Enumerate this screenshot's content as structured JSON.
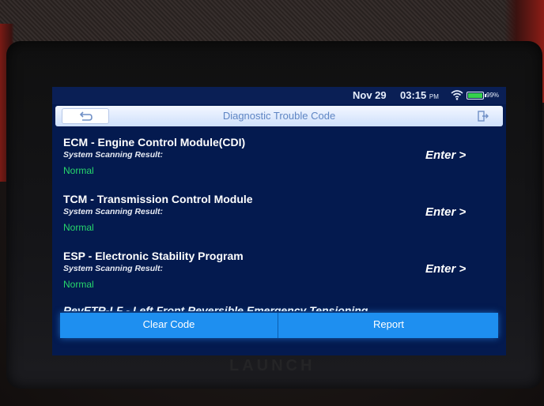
{
  "status_bar": {
    "date": "Nov 29",
    "time": "03:15",
    "ampm": "PM",
    "battery": "99%",
    "battery_color": "#35d14b"
  },
  "header": {
    "title": "Diagnostic Trouble Code",
    "back_icon": "back-arrow-icon",
    "exit_icon": "exit-icon"
  },
  "modules": [
    {
      "name": "ECM - Engine Control Module(CDI)",
      "scan_label": "System Scanning Result:",
      "status": "Normal",
      "enter_label": "Enter >"
    },
    {
      "name": "TCM - Transmission Control Module",
      "scan_label": "System Scanning Result:",
      "status": "Normal",
      "enter_label": "Enter >"
    },
    {
      "name": "ESP - Electronic Stability Program",
      "scan_label": "System Scanning Result:",
      "status": "Normal",
      "enter_label": "Enter >"
    }
  ],
  "partial_module": {
    "name": "RevETR-LF - Left Front Reversible Emergency Tensioning"
  },
  "actions": {
    "clear_code": "Clear Code",
    "report": "Report"
  },
  "device": {
    "brand": "LAUNCH"
  },
  "colors": {
    "screen_bg": "#041a4f",
    "status_ok": "#27d86c",
    "action_bar": "#1e8ff0"
  }
}
